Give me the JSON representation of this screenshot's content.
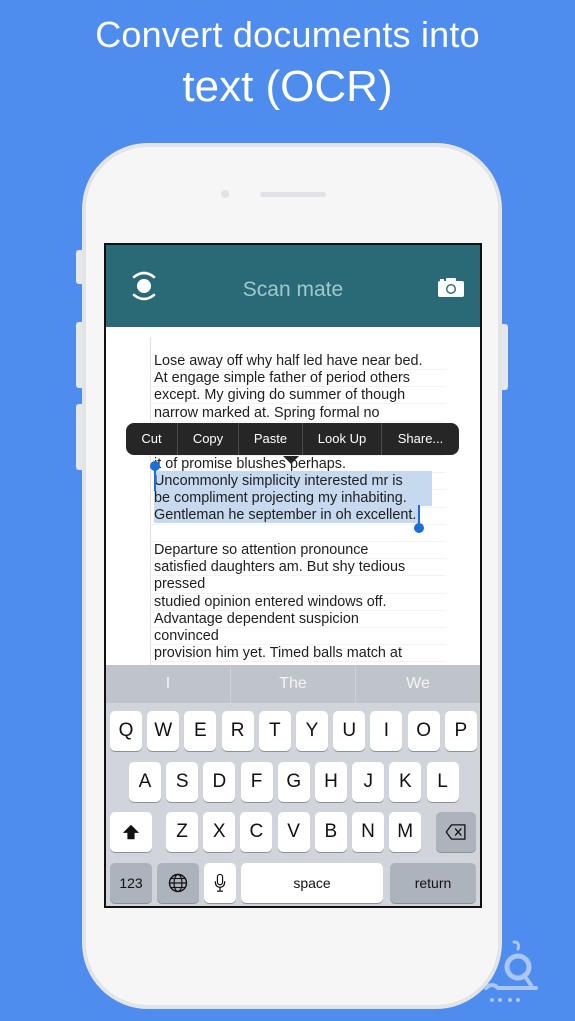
{
  "promo": {
    "headline_line1": "Convert documents into",
    "headline_line2": "text (OCR)",
    "background_color": "#4e8cee"
  },
  "app": {
    "title": "Scan mate",
    "nav_color": "#2a6a76",
    "left_icon": "scan-lens-icon",
    "right_icon": "camera-icon"
  },
  "document": {
    "lines_before": [
      "Lose away off why half led have near bed.",
      "At engage simple father of period others",
      "except. My giving do summer of though",
      "narrow marked at. Spring formal no",
      "it of promise blushes perhaps."
    ],
    "selected_lines": [
      "Uncommonly simplicity interested mr is",
      "be compliment projecting my inhabiting.",
      "Gentleman he september in oh excellent."
    ],
    "lines_after": [
      "Departure so attention pronounce",
      "satisfied daughters am. But shy tedious",
      "pressed",
      "studied opinion entered windows off.",
      "Advantage dependent suspicion",
      "convinced",
      "provision him yet. Timed balls match at"
    ]
  },
  "edit_menu": {
    "items": [
      "Cut",
      "Copy",
      "Paste",
      "Look Up",
      "Share..."
    ]
  },
  "keyboard": {
    "suggestions": [
      "I",
      "The",
      "We"
    ],
    "row1": [
      "Q",
      "W",
      "E",
      "R",
      "T",
      "Y",
      "U",
      "I",
      "O",
      "P"
    ],
    "row2": [
      "A",
      "S",
      "D",
      "F",
      "G",
      "H",
      "J",
      "K",
      "L"
    ],
    "row3": [
      "Z",
      "X",
      "C",
      "V",
      "B",
      "N",
      "M"
    ],
    "shift_icon": "shift-arrow-icon",
    "delete_icon": "backspace-icon",
    "numbers_label": "123",
    "globe_icon": "globe-icon",
    "mic_icon": "microphone-icon",
    "space_label": "space",
    "return_label": "return"
  },
  "watermark": {
    "icon": "sibche-logo-icon"
  }
}
